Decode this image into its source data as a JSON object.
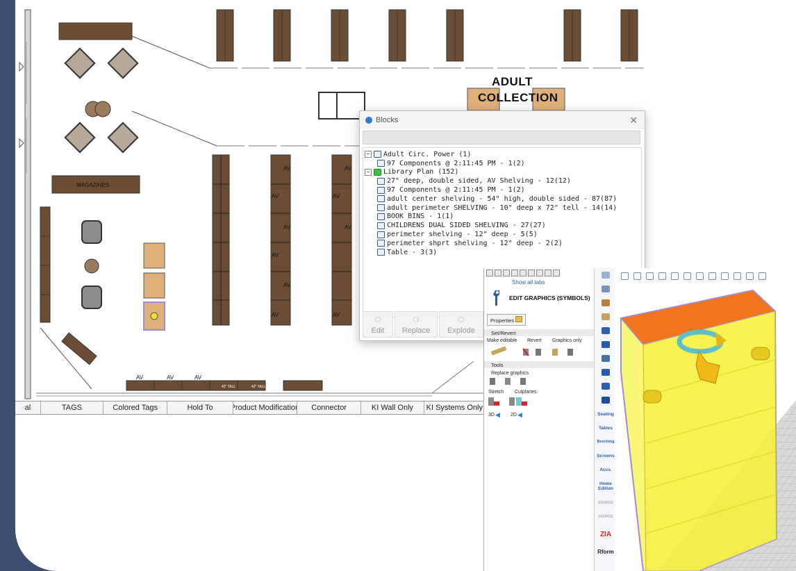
{
  "floorplan": {
    "section_label_line1": "ADULT",
    "section_label_line2": "COLLECTION",
    "magazines_label": "MAGAZINES",
    "av_label": "AV",
    "tall_label": "42\" TALL"
  },
  "tag_bar": {
    "tabs": [
      "al",
      "TAGS",
      "Colored Tags",
      "Hold To",
      "Product Modification",
      "Connector",
      "KI Wall Only",
      "KI Systems Only"
    ]
  },
  "blocks_dialog": {
    "title": "Blocks",
    "tree": [
      {
        "level": 0,
        "toggle": "−",
        "label": "Adult Circ. Power  (1)"
      },
      {
        "level": 1,
        "label": "97 Components @ 2:11:45 PM - 1(2)"
      },
      {
        "level": 0,
        "toggle": "−",
        "label": "Library Plan (152)"
      },
      {
        "level": 1,
        "label": "27\" deep, double sided, AV Shelving - 12(12)"
      },
      {
        "level": 1,
        "label": "97 Components @ 2:11:45 PM - 1(2)"
      },
      {
        "level": 1,
        "label": "adult center shelving - 54\" high, double sided - 87(87)"
      },
      {
        "level": 1,
        "label": "adult perimeter SHELVING - 10\" deep x 72\" tell - 14(14)"
      },
      {
        "level": 1,
        "label": "BOOK BINS - 1(1)"
      },
      {
        "level": 1,
        "label": "CHILDRENS DUAL SIDED SHELVING - 27(27)"
      },
      {
        "level": 1,
        "label": "perimeter shelving - 12\" deep - 5(5)"
      },
      {
        "level": 1,
        "label": "perimeter shprt shelving - 12\" deep - 2(2)"
      },
      {
        "level": 1,
        "label": "Table - 3(3)"
      }
    ],
    "buttons": [
      "Edit",
      "Replace",
      "Explode"
    ]
  },
  "edit_panel": {
    "show_all_tabs": "Show all tabs",
    "title": "EDIT GRAPHICS (SYMBOLS)",
    "properties": "Properties",
    "section_set_revert": "Set/Revert",
    "make_editable": "Make editable",
    "revert": "Revert",
    "graphics_only": "Graphics only",
    "section_tools": "Tools",
    "replace_graphics": "Replace graphics",
    "stretch": "Stretch",
    "cutplanes": "Cutplanes",
    "label_3d": "3D",
    "label_2d": "2D",
    "side_tabs": [
      "Seating",
      "Tables",
      "Benching",
      "Screens",
      "Accs.",
      "Home Edition",
      "SOURCE",
      "SOURCE",
      "ZIA",
      "Rform"
    ]
  },
  "colors": {
    "frame": "#3d4f70",
    "shelf": "#6b4d35",
    "book_bin": "#e0b07a",
    "cabinet_yellow": "#f6f44a",
    "cabinet_top": "#f2741d",
    "side_tab_blue": "#2d5fa8"
  }
}
